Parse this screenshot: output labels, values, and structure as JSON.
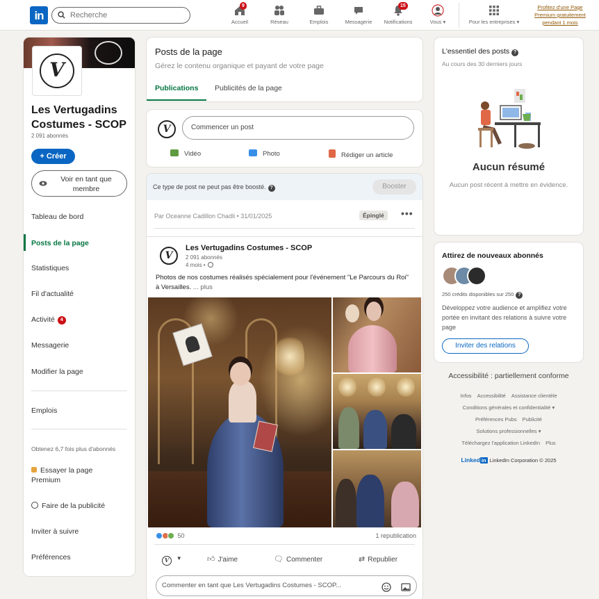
{
  "nav": {
    "logo": "in",
    "search_placeholder": "Recherche",
    "items": [
      {
        "label": "Accueil",
        "icon": "home-icon",
        "badge": "9"
      },
      {
        "label": "Réseau",
        "icon": "network-icon",
        "badge": ""
      },
      {
        "label": "Emplois",
        "icon": "briefcase-icon",
        "badge": ""
      },
      {
        "label": "Messagerie",
        "icon": "message-icon",
        "badge": ""
      },
      {
        "label": "Notifications",
        "icon": "bell-icon",
        "badge": "15"
      },
      {
        "label": "Vous ▾",
        "icon": "avatar-icon",
        "badge": ""
      },
      {
        "label": "Pour les entreprises ▾",
        "icon": "grid-icon",
        "badge": ""
      }
    ],
    "premium_lines": [
      "Profitez d'une Page",
      "Premium gratuitement",
      "pendant 1 mois"
    ]
  },
  "left": {
    "page_name": "Les Vertugadins Costumes - SCOP",
    "followers": "2 091 abonnés",
    "create_label": "+ Créer",
    "view_as_label": "Voir en tant que membre",
    "nav": [
      "Tableau de bord",
      "Posts de la page",
      "Statistiques",
      "Fil d'actualité",
      "Activité",
      "Messagerie",
      "Modifier la page",
      "Emplois"
    ],
    "activity_badge": "4",
    "promo_text": "Obtenez 6,7 fois plus d'abonnés",
    "try_premium": "Essayer la page Premium",
    "advertise": "Faire de la publicité",
    "invite": "Inviter à suivre",
    "preferences": "Préférences"
  },
  "center": {
    "title": "Posts de la page",
    "subtitle": "Gérez le contenu organique et payant de votre page",
    "tabs": [
      "Publications",
      "Publicités de la page"
    ],
    "start_post": "Commencer un post",
    "actions": [
      "Vidéo",
      "Photo",
      "Rédiger un article"
    ],
    "action_colors": [
      "#5f9b41",
      "#378fe9",
      "#e06847"
    ],
    "boost_note": "Ce type de post ne peut pas être boosté.",
    "boost_label": "Booster",
    "byline": "Par Oceanne Cadillon Chadli • 31/01/2025",
    "pinned": "Épinglé",
    "post": {
      "author": "Les Vertugadins Costumes - SCOP",
      "followers": "2 091 abonnés",
      "time": "4 mois •",
      "text": "Photos de nos costumes réalisés spécialement pour l'événement \"Le Parcours du Roi\" à Versailles.",
      "more": "... plus",
      "reactions": "50",
      "reposts": "1 republication",
      "like": "J'aime",
      "comment": "Commenter",
      "repost": "Republier",
      "comment_placeholder": "Commenter en tant que Les Vertugadins Costumes - SCOP..."
    }
  },
  "right": {
    "summary_title": "L'essentiel des posts",
    "summary_sub": "Au cours des 30 derniers jours",
    "no_summary": "Aucun résumé",
    "no_summary_sub": "Aucun post récent à mettre en évidence.",
    "follow_title": "Attirez de nouveaux abonnés",
    "credits": "250 crédits disponibles sur 250",
    "follow_text": "Développez votre audience et amplifiez votre portée en invitant des relations à suivre votre page",
    "invite_btn": "Inviter des relations",
    "accessibility": "Accessibilité : partiellement conforme",
    "footer_rows": [
      [
        "Infos",
        "Accessibilité",
        "Assistance clientèle"
      ],
      [
        "Conditions générales et confidentialité ▾"
      ],
      [
        "Préférences Pubs",
        "Publicité"
      ],
      [
        "Solutions professionnelles ▾"
      ],
      [
        "Téléchargez l'application LinkedIn",
        "Plus"
      ]
    ],
    "brand": "Linked",
    "brand_in": "in",
    "copyright": "LinkedIn Corporation © 2025"
  },
  "colors": {
    "brand_blue": "#0a66c2",
    "active_green": "#057642",
    "badge_red": "#cc1016",
    "premium_gold": "#915907"
  }
}
